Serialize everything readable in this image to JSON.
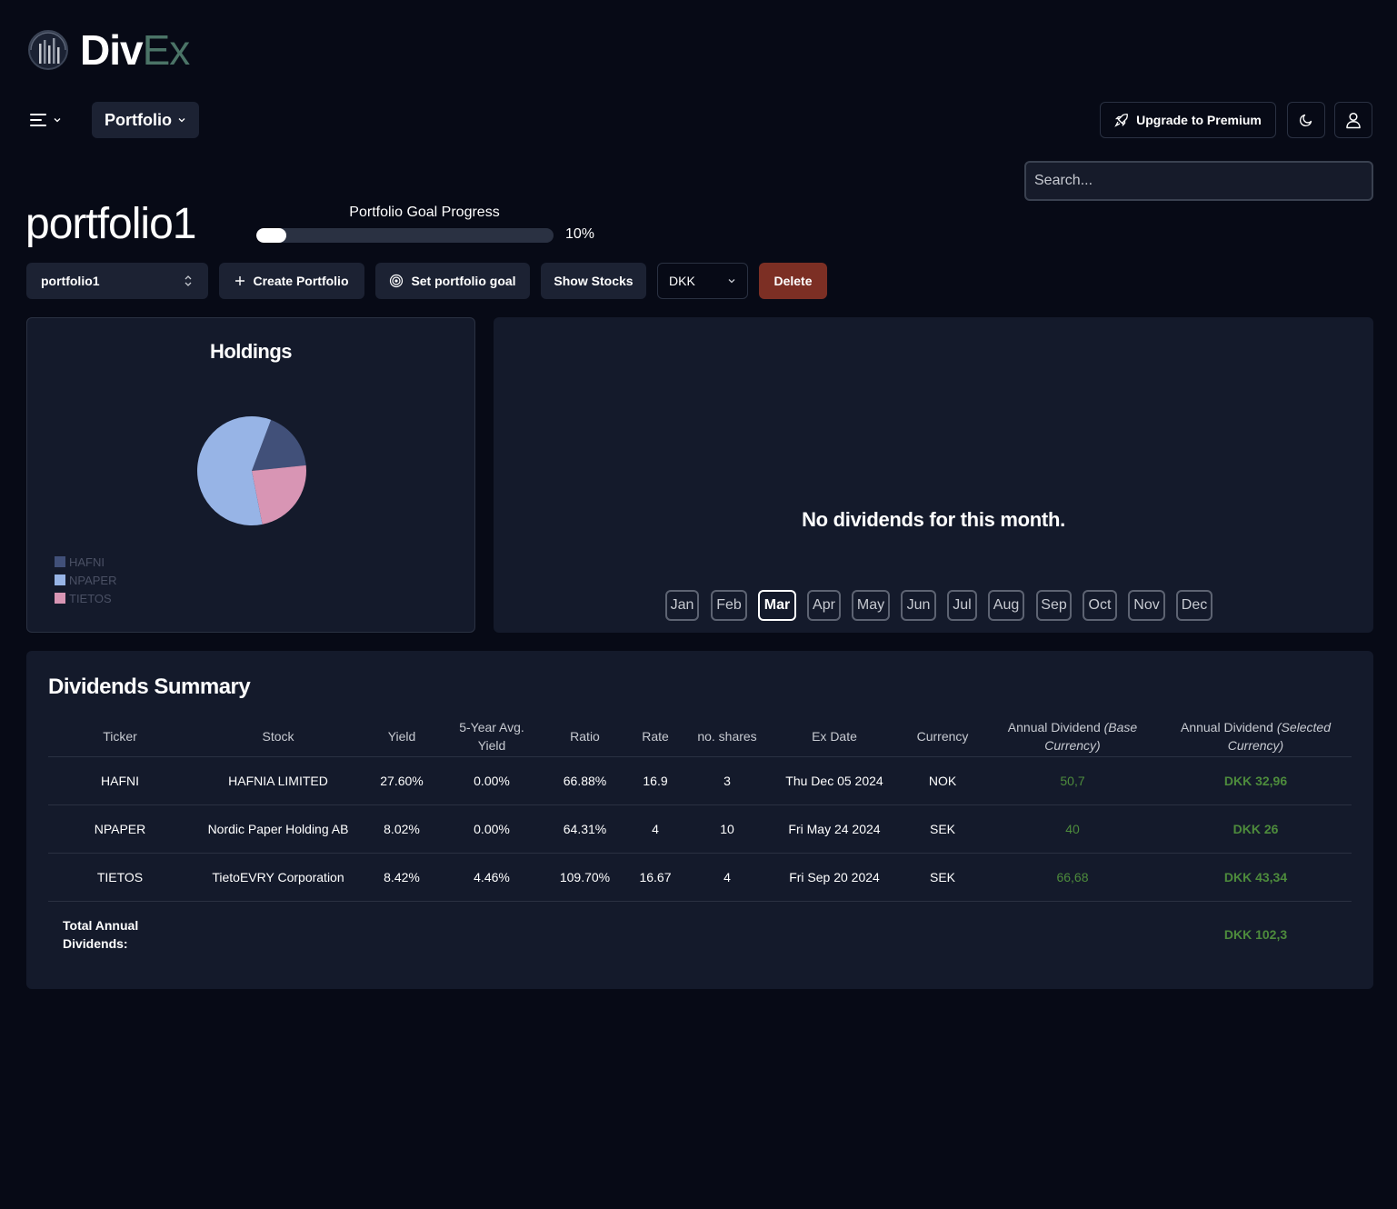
{
  "brand": {
    "name_main": "Div",
    "name_accent": "Ex"
  },
  "nav": {
    "section_label": "Portfolio"
  },
  "header": {
    "upgrade_label": "Upgrade to Premium"
  },
  "search": {
    "placeholder": "Search..."
  },
  "portfolio": {
    "title": "portfolio1",
    "goal_label": "Portfolio Goal Progress",
    "goal_percent_text": "10%",
    "goal_progress_fraction": 0.1,
    "selected": "portfolio1"
  },
  "toolbar": {
    "create_label": "Create Portfolio",
    "goal_label": "Set portfolio goal",
    "show_stocks_label": "Show Stocks",
    "currency": "DKK",
    "delete_label": "Delete"
  },
  "holdings": {
    "title": "Holdings",
    "legend": [
      {
        "label": "HAFNI",
        "color": "#415079"
      },
      {
        "label": "NPAPER",
        "color": "#97b4e6"
      },
      {
        "label": "TIETOS",
        "color": "#d895b4"
      }
    ]
  },
  "chart_data": {
    "type": "pie",
    "labels": [
      "HAFNI",
      "NPAPER",
      "TIETOS"
    ],
    "values": [
      3,
      10,
      4
    ],
    "colors": [
      "#415079",
      "#97b4e6",
      "#d895b4"
    ]
  },
  "monthly": {
    "empty_text": "No dividends for this month.",
    "months": [
      "Jan",
      "Feb",
      "Mar",
      "Apr",
      "May",
      "Jun",
      "Jul",
      "Aug",
      "Sep",
      "Oct",
      "Nov",
      "Dec"
    ],
    "active_month": "Mar"
  },
  "summary": {
    "title": "Dividends Summary",
    "columns": {
      "ticker": "Ticker",
      "stock": "Stock",
      "yield": "Yield",
      "avg_yield": "5-Year Avg. Yield",
      "ratio": "Ratio",
      "rate": "Rate",
      "shares": "no. shares",
      "ex_date": "Ex Date",
      "currency": "Currency",
      "annual_base_prefix": "Annual Dividend ",
      "annual_base_suffix": "(Base Currency)",
      "annual_sel_prefix": "Annual Dividend ",
      "annual_sel_suffix": "(Selected Currency)"
    },
    "rows": [
      {
        "ticker": "HAFNI",
        "stock": "HAFNIA LIMITED",
        "yield": "27.60%",
        "avg_yield": "0.00%",
        "ratio": "66.88%",
        "rate": "16.9",
        "shares": "3",
        "ex_date": "Thu Dec 05 2024",
        "currency": "NOK",
        "annual_base": "50,7",
        "annual_selected": "DKK 32,96"
      },
      {
        "ticker": "NPAPER",
        "stock": "Nordic Paper Holding AB",
        "yield": "8.02%",
        "avg_yield": "0.00%",
        "ratio": "64.31%",
        "rate": "4",
        "shares": "10",
        "ex_date": "Fri May 24 2024",
        "currency": "SEK",
        "annual_base": "40",
        "annual_selected": "DKK 26"
      },
      {
        "ticker": "TIETOS",
        "stock": "TietoEVRY Corporation",
        "yield": "8.42%",
        "avg_yield": "4.46%",
        "ratio": "109.70%",
        "rate": "16.67",
        "shares": "4",
        "ex_date": "Fri Sep 20 2024",
        "currency": "SEK",
        "annual_base": "66,68",
        "annual_selected": "DKK 43,34"
      }
    ],
    "total_label": "Total Annual Dividends:",
    "total_value": "DKK 102,3"
  }
}
